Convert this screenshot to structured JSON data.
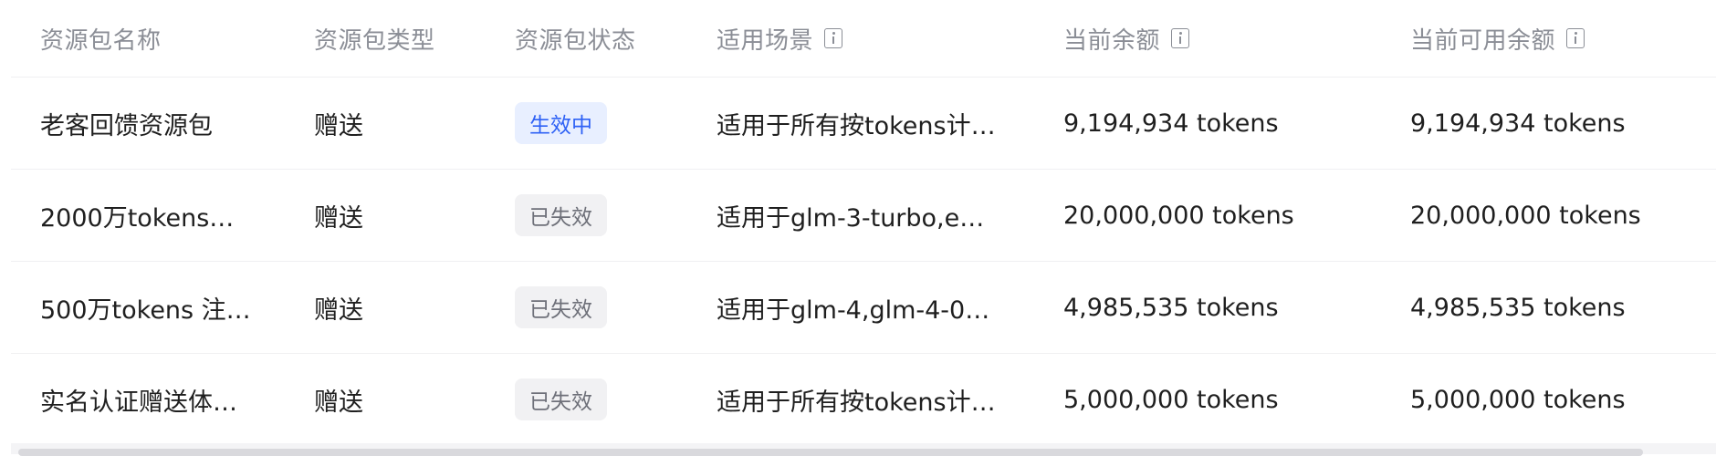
{
  "table": {
    "headers": {
      "name": "资源包名称",
      "type": "资源包类型",
      "status": "资源包状态",
      "scene": "适用场景",
      "balance": "当前余额",
      "available": "当前可用余额"
    },
    "header_icons": {
      "scene": "info-icon",
      "balance": "info-icon",
      "available": "info-icon"
    },
    "rows": [
      {
        "name": "老客回馈资源包",
        "type": "赠送",
        "status": "生效中",
        "status_kind": "active",
        "scene": "适用于所有按tokens计…",
        "balance": "9,194,934 tokens",
        "available": "9,194,934 tokens"
      },
      {
        "name": "2000万tokens…",
        "type": "赠送",
        "status": "已失效",
        "status_kind": "inactive",
        "scene": "适用于glm-3-turbo,e…",
        "balance": "20,000,000 tokens",
        "available": "20,000,000 tokens"
      },
      {
        "name": "500万tokens 注…",
        "type": "赠送",
        "status": "已失效",
        "status_kind": "inactive",
        "scene": "适用于glm-4,glm-4-0…",
        "balance": "4,985,535 tokens",
        "available": "4,985,535 tokens"
      },
      {
        "name": "实名认证赠送体…",
        "type": "赠送",
        "status": "已失效",
        "status_kind": "inactive",
        "scene": "适用于所有按tokens计…",
        "balance": "5,000,000 tokens",
        "available": "5,000,000 tokens"
      }
    ]
  },
  "colors": {
    "active_badge_bg": "#e8efff",
    "active_badge_text": "#2f62f5",
    "inactive_badge_bg": "#f1f1f3",
    "inactive_badge_text": "#6e7079",
    "header_text": "#8b8e96"
  }
}
